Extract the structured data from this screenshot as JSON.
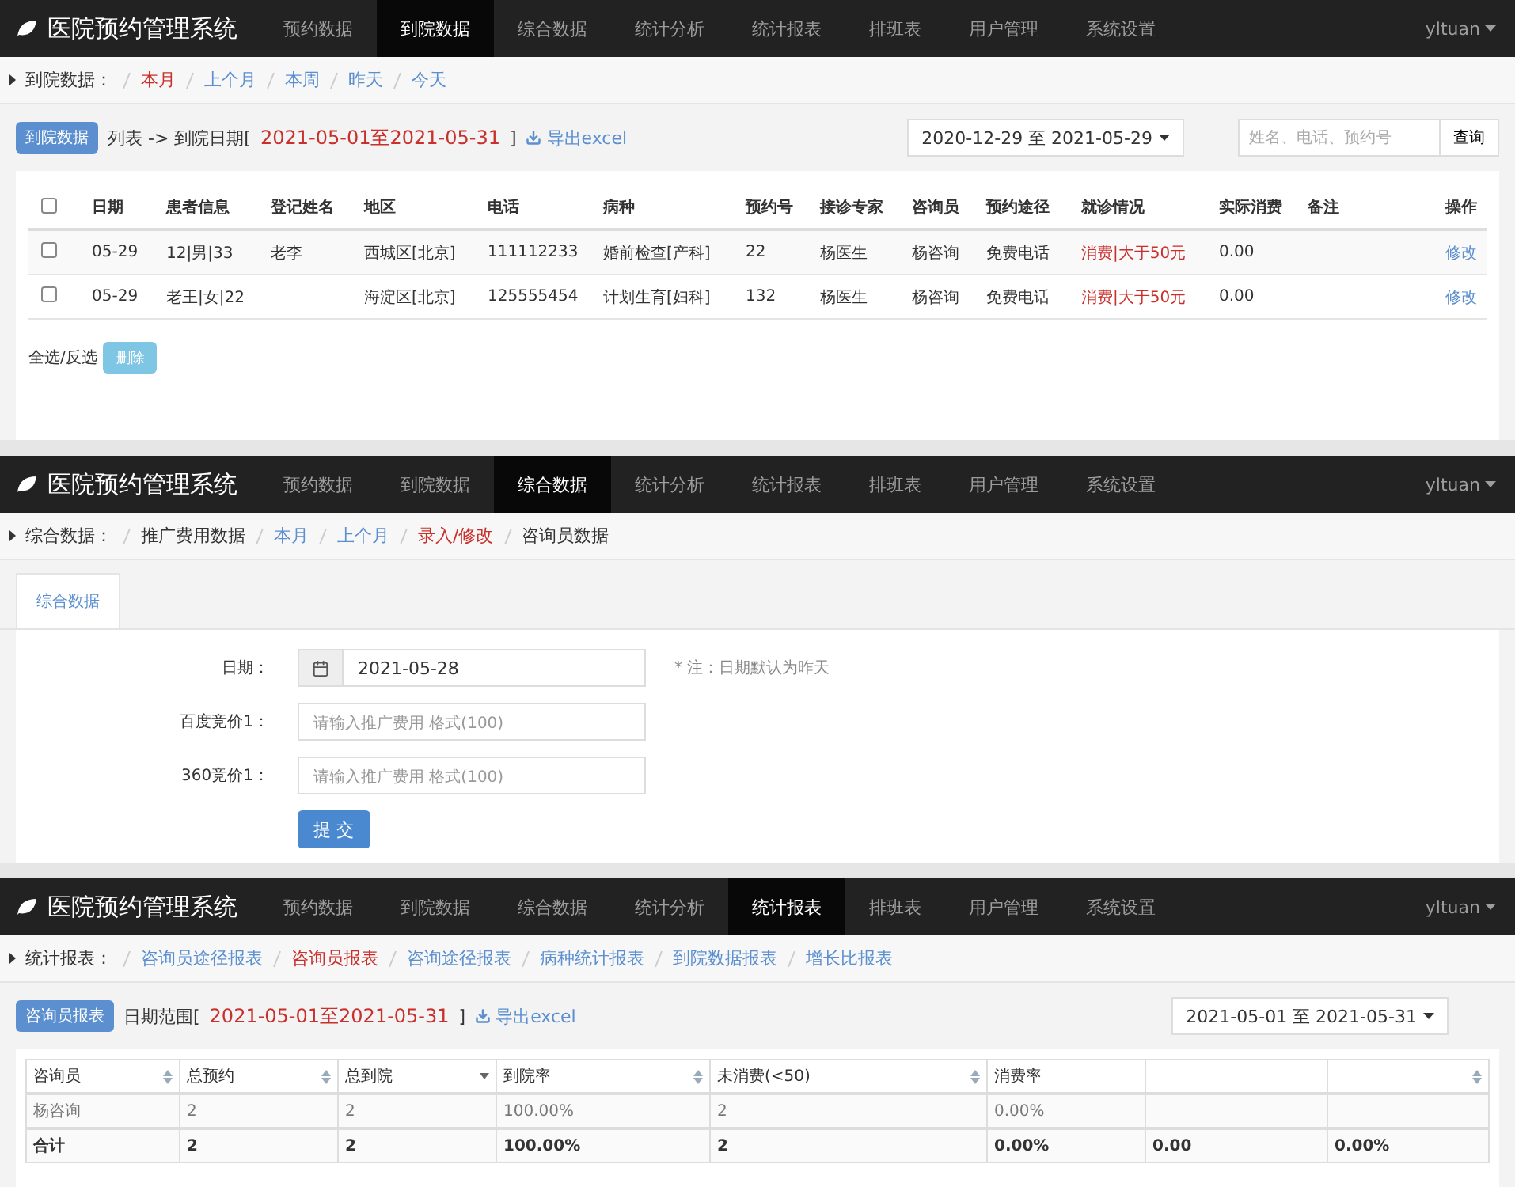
{
  "screens": [
    {
      "kind": "arrivals",
      "navbar": {
        "brand": "医院预约管理系统",
        "user": "yltuan",
        "items": [
          {
            "label": "预约数据",
            "selected": false
          },
          {
            "label": "到院数据",
            "selected": true
          },
          {
            "label": "综合数据",
            "selected": false
          },
          {
            "label": "统计分析",
            "selected": false
          },
          {
            "label": "统计报表",
            "selected": false
          },
          {
            "label": "排班表",
            "selected": false
          },
          {
            "label": "用户管理",
            "selected": false
          },
          {
            "label": "系统设置",
            "selected": false
          }
        ]
      },
      "breadcrumb": {
        "label": "到院数据：",
        "links": [
          {
            "label": "本月",
            "selected": true
          },
          {
            "label": "上个月",
            "selected": false,
            "kind": "link"
          },
          {
            "label": "本周",
            "selected": false,
            "kind": "link"
          },
          {
            "label": "昨天",
            "selected": false,
            "kind": "link"
          },
          {
            "label": "今天",
            "selected": false,
            "kind": "link"
          }
        ]
      },
      "header": {
        "badge": "到院数据",
        "prefix": "列表 -> 到院日期[",
        "range": "2021-05-01至2021-05-31",
        "suffix": "]",
        "export": "导出excel"
      },
      "date_range": "2020-12-29 至 2021-05-29",
      "search": {
        "placeholder": "姓名、电话、预约号",
        "button": "查询"
      },
      "table": {
        "all_checked": false,
        "columns": [
          {
            "label": "日期",
            "kind": "text"
          },
          {
            "label": "患者信息",
            "kind": "text"
          },
          {
            "label": "登记姓名",
            "kind": "text"
          },
          {
            "label": "地区",
            "kind": "text"
          },
          {
            "label": "电话",
            "kind": "text"
          },
          {
            "label": "病种",
            "kind": "text"
          },
          {
            "label": "预约号",
            "kind": "text"
          },
          {
            "label": "接诊专家",
            "kind": "text"
          },
          {
            "label": "咨询员",
            "kind": "text"
          },
          {
            "label": "预约途径",
            "kind": "text"
          },
          {
            "label": "就诊情况",
            "kind": "status"
          },
          {
            "label": "实际消费",
            "kind": "text"
          },
          {
            "label": "备注",
            "kind": "text"
          },
          {
            "label": "操作",
            "kind": "link"
          }
        ],
        "rows": [
          {
            "checked": false,
            "cells": [
              "05-29",
              "12|男|33",
              "老李",
              "西城区[北京]",
              "111112233",
              "婚前检查[产科]",
              "22",
              "杨医生",
              "杨咨询",
              "免费电话",
              "消费|大于50元",
              "0.00",
              "",
              "修改"
            ]
          },
          {
            "checked": false,
            "cells": [
              "05-29",
              "老王|女|22",
              "",
              "海淀区[北京]",
              "125555454",
              "计划生育[妇科]",
              "132",
              "杨医生",
              "杨咨询",
              "免费电话",
              "消费|大于50元",
              "0.00",
              "",
              "修改"
            ]
          }
        ]
      },
      "footer": {
        "select_all": "全选/反选",
        "delete_button": "删除",
        "delete_disabled": true
      }
    },
    {
      "kind": "form",
      "navbar": {
        "brand": "医院预约管理系统",
        "user": "yltuan",
        "items": [
          {
            "label": "预约数据",
            "selected": false
          },
          {
            "label": "到院数据",
            "selected": false
          },
          {
            "label": "综合数据",
            "selected": true
          },
          {
            "label": "统计分析",
            "selected": false
          },
          {
            "label": "统计报表",
            "selected": false
          },
          {
            "label": "排班表",
            "selected": false
          },
          {
            "label": "用户管理",
            "selected": false
          },
          {
            "label": "系统设置",
            "selected": false
          }
        ]
      },
      "breadcrumb": {
        "label": "综合数据：",
        "links": [
          {
            "label": "推广费用数据",
            "selected": false,
            "kind": "text"
          },
          {
            "label": "本月",
            "selected": false,
            "kind": "link"
          },
          {
            "label": "上个月",
            "selected": false,
            "kind": "link"
          },
          {
            "label": "录入/修改",
            "selected": true
          },
          {
            "label": "咨询员数据",
            "selected": false,
            "kind": "text"
          }
        ]
      },
      "tabs": [
        {
          "label": "综合数据",
          "selected": true
        }
      ],
      "fields": [
        {
          "label": "日期：",
          "kind": "date",
          "value": "2021-05-28",
          "note": "* 注：日期默认为昨天"
        },
        {
          "label": "百度竞价1：",
          "kind": "text",
          "placeholder": "请输入推广费用 格式(100)"
        },
        {
          "label": "360竞价1：",
          "kind": "text",
          "placeholder": "请输入推广费用 格式(100)"
        }
      ],
      "submit": "提 交"
    },
    {
      "kind": "report",
      "navbar": {
        "brand": "医院预约管理系统",
        "user": "yltuan",
        "items": [
          {
            "label": "预约数据",
            "selected": false
          },
          {
            "label": "到院数据",
            "selected": false
          },
          {
            "label": "综合数据",
            "selected": false
          },
          {
            "label": "统计分析",
            "selected": false
          },
          {
            "label": "统计报表",
            "selected": true
          },
          {
            "label": "排班表",
            "selected": false
          },
          {
            "label": "用户管理",
            "selected": false
          },
          {
            "label": "系统设置",
            "selected": false
          }
        ]
      },
      "breadcrumb": {
        "label": "统计报表：",
        "links": [
          {
            "label": "咨询员途径报表",
            "selected": false,
            "kind": "link"
          },
          {
            "label": "咨询员报表",
            "selected": true
          },
          {
            "label": "咨询途径报表",
            "selected": false,
            "kind": "link"
          },
          {
            "label": "病种统计报表",
            "selected": false,
            "kind": "link"
          },
          {
            "label": "到院数据报表",
            "selected": false,
            "kind": "link"
          },
          {
            "label": "增长比报表",
            "selected": false,
            "kind": "link"
          }
        ]
      },
      "header": {
        "badge": "咨询员报表",
        "prefix": "日期范围[",
        "range": "2021-05-01至2021-05-31",
        "suffix": "]",
        "export": "导出excel"
      },
      "date_range": "2021-05-01 至 2021-05-31",
      "table": {
        "columns": [
          {
            "label": "咨询员",
            "sortable": true,
            "sorted": false
          },
          {
            "label": "总预约",
            "sortable": true,
            "sorted": false
          },
          {
            "label": "总到院",
            "sortable": true,
            "sorted": true
          },
          {
            "label": "到院率",
            "sortable": true,
            "sorted": false
          },
          {
            "label": "未消费(<50)",
            "sortable": true,
            "sorted": false
          },
          {
            "label": "消费率",
            "sortable": false,
            "sorted": false
          },
          {
            "sortable": false,
            "sorted": false
          },
          {
            "sortable": true,
            "sorted": false
          }
        ],
        "rows": [
          {
            "kind": "data",
            "cells": [
              "杨咨询",
              "2",
              "2",
              "100.00%",
              "2",
              "0.00%"
            ]
          },
          {
            "kind": "total",
            "cells": [
              "合计",
              "2",
              "2",
              "100.00%",
              "2",
              "0.00%",
              "0.00",
              "0.00%"
            ]
          }
        ]
      }
    }
  ]
}
